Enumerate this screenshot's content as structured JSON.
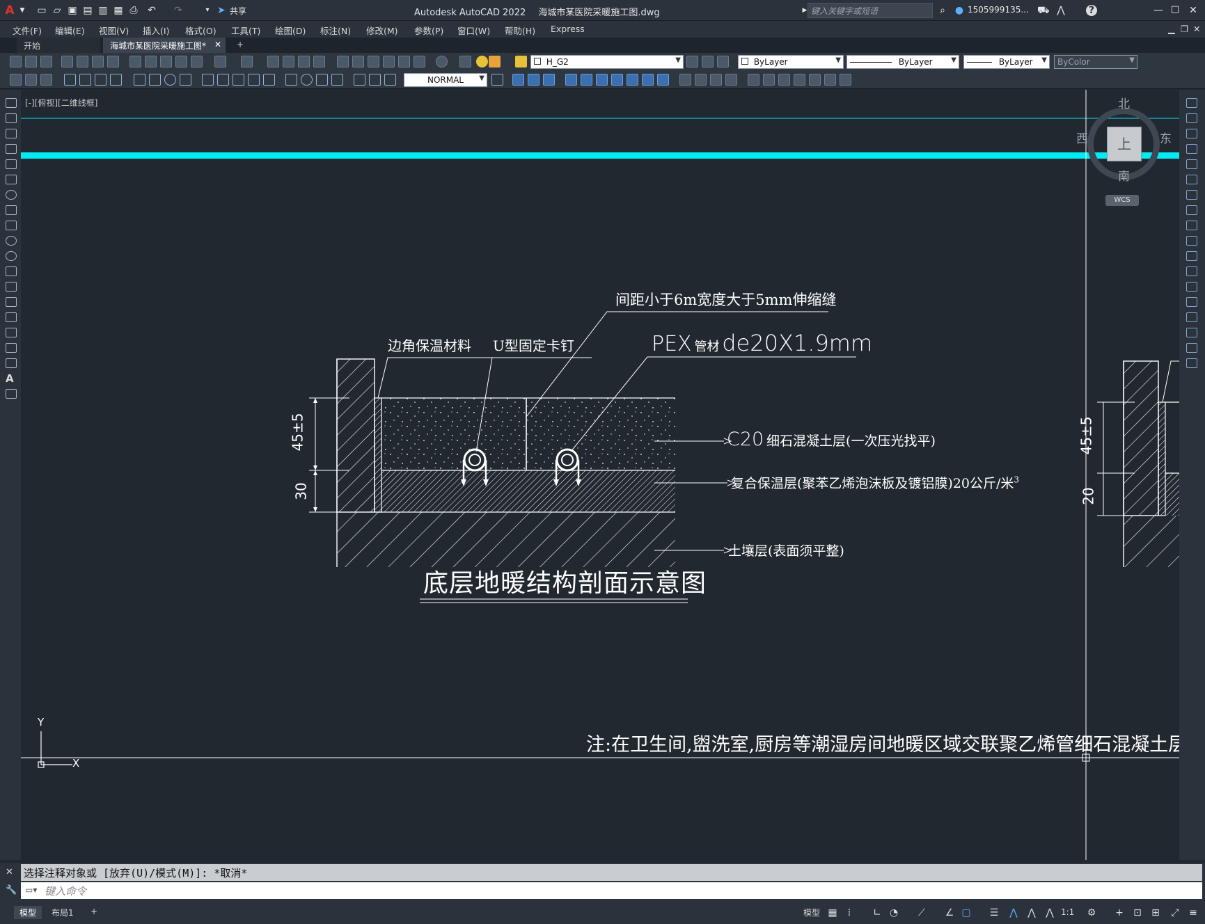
{
  "app": {
    "logo": "A",
    "title": "Autodesk AutoCAD 2022",
    "filename": "海城市某医院采暖施工图.dwg",
    "share_label": "共享",
    "search_placeholder": "键入关键字或短语",
    "user": "1505999135..."
  },
  "menu": [
    "文件(F)",
    "编辑(E)",
    "视图(V)",
    "插入(I)",
    "格式(O)",
    "工具(T)",
    "绘图(D)",
    "标注(N)",
    "修改(M)",
    "参数(P)",
    "窗口(W)",
    "帮助(H)",
    "Express"
  ],
  "tabs": {
    "start": "开始",
    "active": "海城市某医院采暖施工图*",
    "add": "+"
  },
  "toolbar": {
    "layer": "H_G2",
    "color": "ByLayer",
    "linetype": "ByLayer",
    "lineweight": "ByLayer",
    "plotstyle": "ByColor",
    "dimstyle": "NORMAL"
  },
  "viewport": {
    "label": "[-][俯视][二维线框]"
  },
  "viewcube": {
    "north": "北",
    "south": "南",
    "east": "东",
    "west": "西",
    "top": "上",
    "wcs": "WCS"
  },
  "drawing": {
    "label_corner_insulation": "边角保温材料",
    "label_u_clip": "U型固定卡钉",
    "label_joint": "间距小于6m宽度大于5mm伸缩缝",
    "label_pex": "PEX",
    "label_pex_small": "管材",
    "label_pex_spec": "de20X1.9mm",
    "label_c20": "C20",
    "label_c20_rest": "细石混凝土层(一次压光找平)",
    "label_insulation": "复合保温层(聚苯乙烯泡沫板及镀铝膜)20公斤/米",
    "label_insulation_sup": "3",
    "label_soil": "土壤层(表面须平整)",
    "dim_45": "45±5",
    "dim_30": "30",
    "dim_45_right": "45±5",
    "dim_20_right": "20",
    "title": "底层地暖结构剖面示意图",
    "note": "注:在卫生间,盥洗室,厨房等潮湿房间地暖区域交联聚乙烯管细石混凝土层上",
    "ucs_x": "X",
    "ucs_y": "Y"
  },
  "command": {
    "history": "选择注释对象或 [放弃(U)/模式(M)]: *取消*",
    "placeholder": "键入命令"
  },
  "status": {
    "model_tab": "模型",
    "layout_tab": "布局1",
    "add": "+",
    "model_button": "模型",
    "scale": "1:1"
  }
}
